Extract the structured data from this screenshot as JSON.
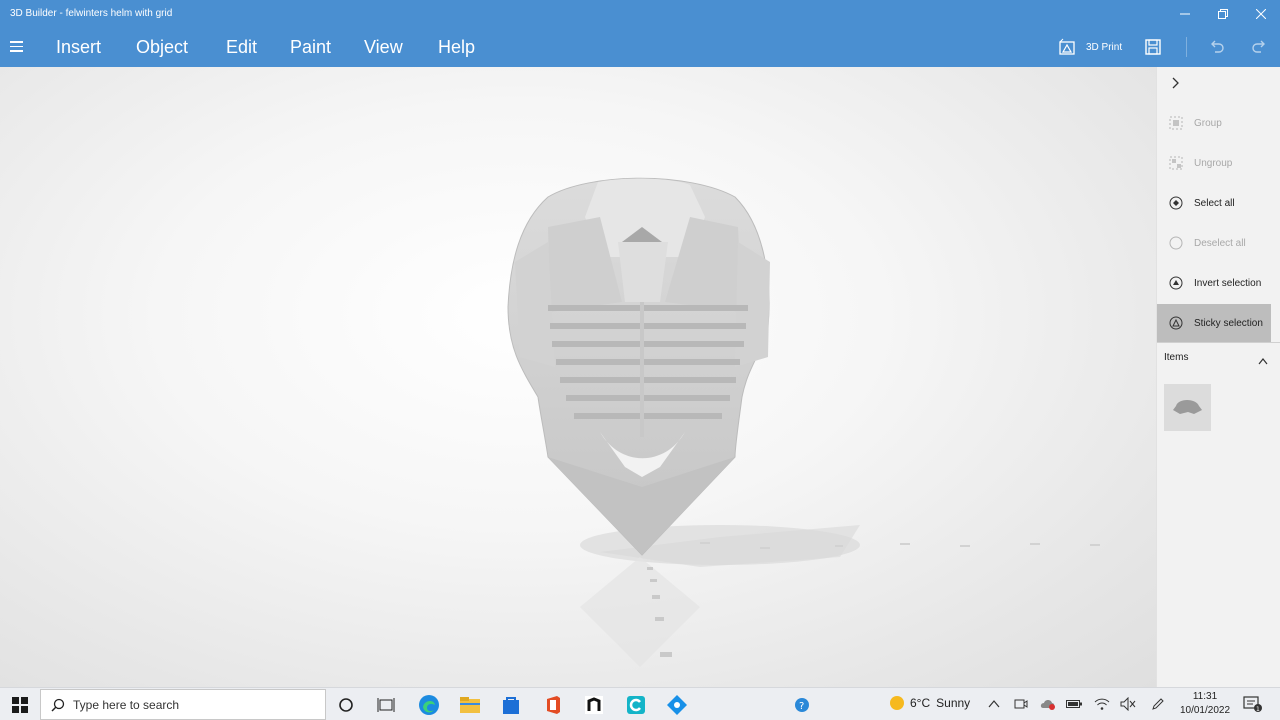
{
  "window": {
    "title": "3D Builder - felwinters helm with grid"
  },
  "menu": {
    "items": [
      "Insert",
      "Object",
      "Edit",
      "Paint",
      "View",
      "Help"
    ],
    "print_label": "3D Print"
  },
  "side_panel": {
    "actions": [
      {
        "label": "Group",
        "icon": "group-icon",
        "state": "disabled"
      },
      {
        "label": "Ungroup",
        "icon": "ungroup-icon",
        "state": "disabled"
      },
      {
        "label": "Select all",
        "icon": "select-all-icon",
        "state": "enabled"
      },
      {
        "label": "Deselect all",
        "icon": "deselect-all-icon",
        "state": "disabled"
      },
      {
        "label": "Invert selection",
        "icon": "invert-selection-icon",
        "state": "enabled"
      },
      {
        "label": "Sticky selection",
        "icon": "sticky-selection-icon",
        "state": "active"
      }
    ],
    "items_header": "Items"
  },
  "taskbar": {
    "search_placeholder": "Type here to search",
    "weather": {
      "temp": "6°C",
      "condition": "Sunny"
    },
    "time": "11:31",
    "date": "10/01/2022"
  },
  "colors": {
    "accent": "#4a8fd1",
    "panel": "#f2f2f2",
    "active": "#bdbdbd"
  }
}
